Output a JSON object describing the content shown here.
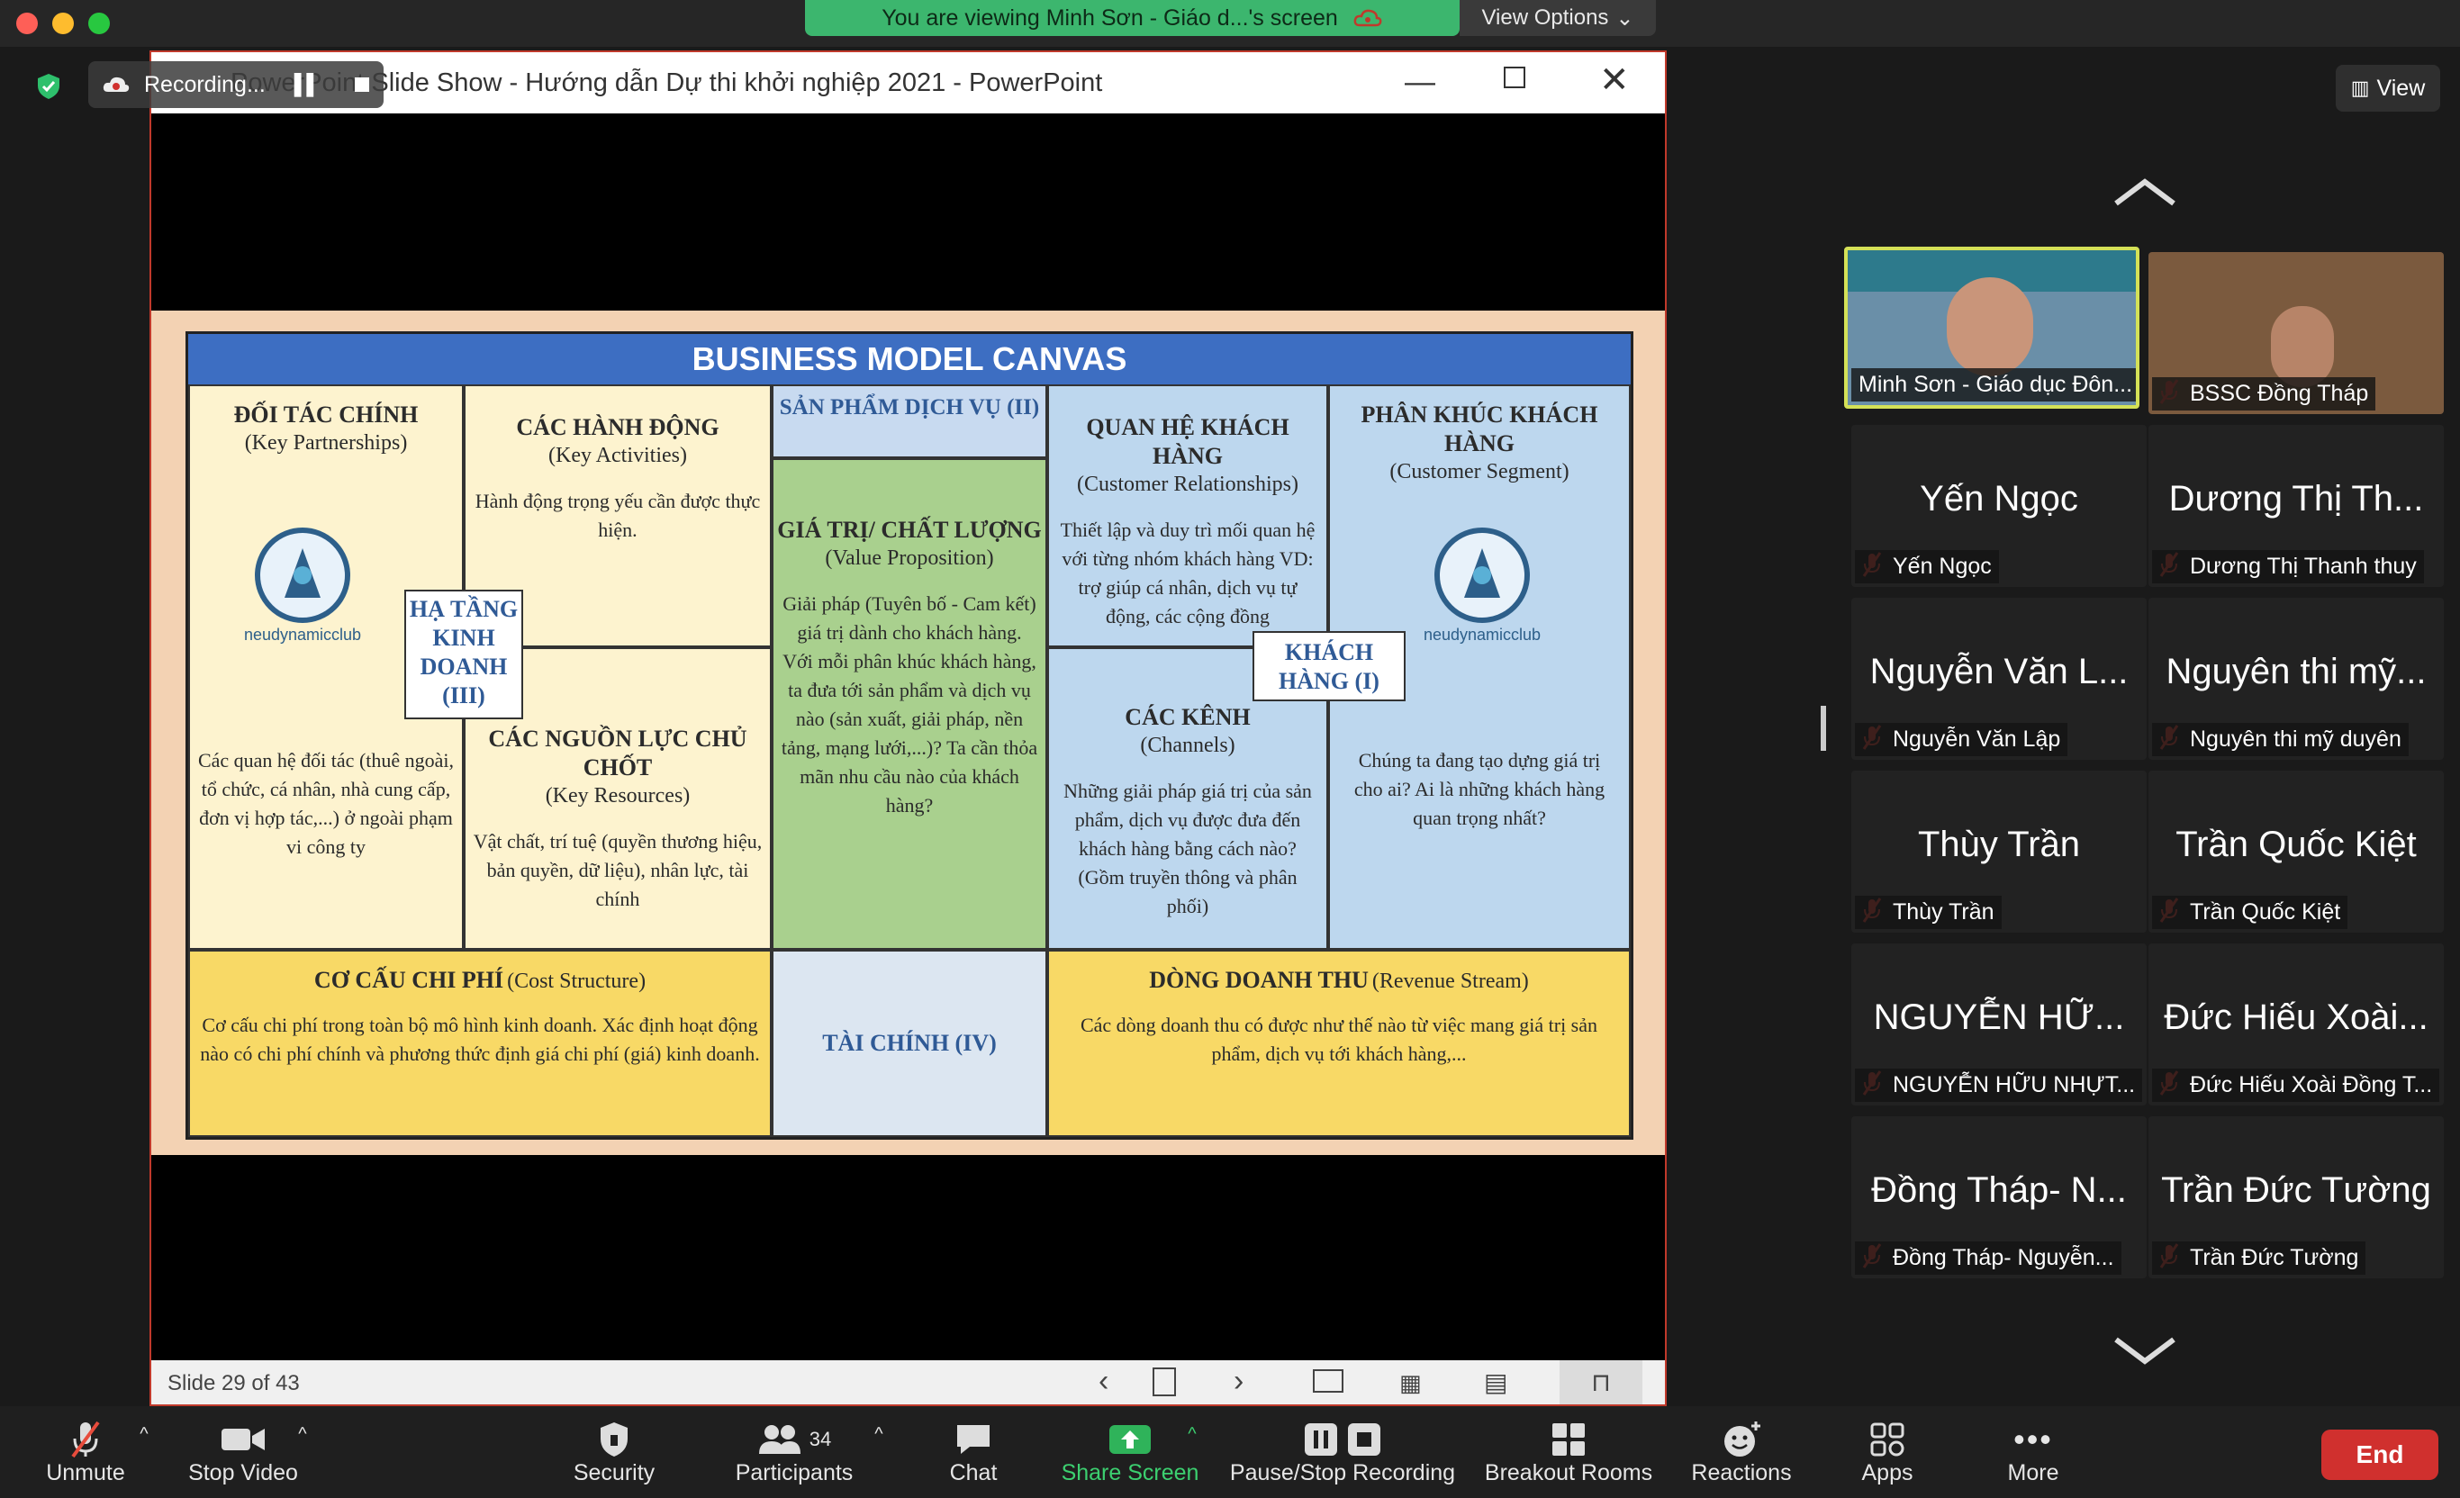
{
  "top": {
    "viewing_text": "You are viewing Minh Sơn - Giáo d...'s screen",
    "view_options": "View Options"
  },
  "recording": {
    "label": "Recording..."
  },
  "ppt": {
    "window_title": "PowerPoint Slide Show  -  Hướng dẫn Dự thi khởi nghiệp 2021 - PowerPoint",
    "slide_counter": "Slide 29 of 43"
  },
  "slide": {
    "title": "BUSINESS MODEL CANVAS",
    "kp_title": "ĐỐI TÁC CHÍNH",
    "kp_sub": "(Key Partnerships)",
    "kp_body": "Các quan hệ đối tác (thuê ngoài, tổ chức, cá nhân, nhà cung cấp, đơn vị hợp tác,...) ở ngoài phạm vi công ty",
    "ka_title": "CÁC HÀNH ĐỘNG",
    "ka_sub": "(Key Activities)",
    "ka_body": "Hành động trọng yếu cần được thực hiện.",
    "infra": "HẠ TẦNG KINH DOANH (III)",
    "kr_title": "CÁC NGUỒN LỰC CHỦ CHỐT",
    "kr_sub": "(Key Resources)",
    "kr_body": "Vật chất, trí tuệ (quyền thương hiệu, bản quyền, dữ liệu), nhân lực, tài chính",
    "product": "SẢN PHẨM DỊCH VỤ (II)",
    "vp_title": "GIÁ TRỊ/ CHẤT LƯỢNG",
    "vp_sub": "(Value Proposition)",
    "vp_body": "Giải pháp (Tuyên bố - Cam kết) giá trị dành cho khách hàng. Với mỗi phân khúc khách hàng, ta đưa tới sản phẩm và dịch vụ nào (sản xuất, giải pháp, nền tảng, mạng lưới,...)? Ta cần thỏa mãn nhu cầu nào của khách hàng?",
    "cr_title": "QUAN HỆ KHÁCH HÀNG",
    "cr_sub": "(Customer Relationships)",
    "cr_body": "Thiết lập và duy trì mối quan hệ với từng nhóm khách hàng VD: trợ giúp cá nhân, dịch vụ tự động, các cộng đồng",
    "customer": "KHÁCH HÀNG (I)",
    "ch_title": "CÁC KÊNH",
    "ch_sub": "(Channels)",
    "ch_body": "Những giải pháp giá trị của sản phẩm, dịch vụ được đưa đến khách hàng bằng cách nào? (Gồm truyền thông và phân phối)",
    "cs_title": "PHÂN KHÚC KHÁCH HÀNG",
    "cs_sub": "(Customer Segment)",
    "cs_body": "Chúng ta đang tạo dựng giá trị cho ai? Ai là những khách hàng quan trọng nhất?",
    "cost_title": "CƠ CẤU CHI PHÍ",
    "cost_sub": "(Cost Structure)",
    "cost_body": "Cơ cấu chi phí trong toàn bộ mô hình kinh doanh. Xác định hoạt động nào có chi phí chính và phương thức định giá chi phí (giá) kinh doanh.",
    "finance": "TÀI CHÍNH (IV)",
    "rev_title": "DÒNG DOANH THU",
    "rev_sub": "(Revenue Stream)",
    "rev_body": "Các dòng doanh thu có được như thế nào từ việc mang giá trị sản phẩm, dịch vụ tới khách hàng,...",
    "logo_text": "neudynamicclub",
    "colors": {
      "kp": "#fdf3cf",
      "ka": "#fdf3cf",
      "prod": "#c8daf0",
      "vp": "#a9d08e",
      "cr": "#bdd7ee",
      "cs": "#bdd7ee",
      "cost": "#f8d966",
      "fin": "#dce6f1",
      "rev": "#f8d966",
      "header": "#3d6ec2"
    }
  },
  "panel": {
    "view_label": "View",
    "tiles": [
      {
        "name": "Minh Sơn - Giáo dục Đôn...",
        "video": true
      },
      {
        "name": "BSSC Đồng Tháp",
        "video": true
      },
      {
        "big": "Yến Ngọc",
        "name": "Yến Ngọc"
      },
      {
        "big": "Dương Thị Th...",
        "name": "Dương Thị Thanh thuy"
      },
      {
        "big": "Nguyễn Văn L...",
        "name": "Nguyễn Văn Lập"
      },
      {
        "big": "Nguyên thi mỹ...",
        "name": "Nguyên thi mỹ duyên"
      },
      {
        "big": "Thùy Trần",
        "name": "Thùy Trần"
      },
      {
        "big": "Trần Quốc Kiệt",
        "name": "Trần Quốc Kiệt"
      },
      {
        "big": "NGUYỄN HỮ...",
        "name": "NGUYỄN HỮU NHỰT..."
      },
      {
        "big": "Đức Hiếu Xoài...",
        "name": "Đức Hiếu Xoài Đồng T..."
      },
      {
        "big": "Đồng Tháp- N...",
        "name": "Đồng Tháp- Nguyễn..."
      },
      {
        "big": "Trần Đức Tường",
        "name": "Trần Đức Tường"
      }
    ]
  },
  "toolbar": {
    "unmute": "Unmute",
    "stop_video": "Stop Video",
    "security": "Security",
    "participants": "Participants",
    "participants_count": "34",
    "chat": "Chat",
    "share": "Share Screen",
    "pause_rec": "Pause/Stop Recording",
    "breakout": "Breakout Rooms",
    "reactions": "Reactions",
    "apps": "Apps",
    "more": "More",
    "end": "End"
  }
}
